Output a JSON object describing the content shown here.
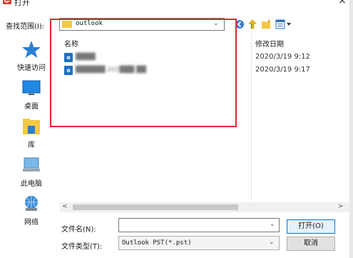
{
  "window": {
    "title": "打开",
    "close_glyph": "×"
  },
  "lookin": {
    "label": "查找范围(I):",
    "value": "outlook"
  },
  "places": [
    {
      "label": "快速访问",
      "icon": "star-icon"
    },
    {
      "label": "桌面",
      "icon": "desktop-icon"
    },
    {
      "label": "库",
      "icon": "library-icon"
    },
    {
      "label": "此电脑",
      "icon": "computer-icon"
    },
    {
      "label": "网络",
      "icon": "network-icon"
    }
  ],
  "filelist": {
    "columns": {
      "name": "名称",
      "date": "修改日期"
    },
    "rows": [
      {
        "name": "████",
        "date": "2020/3/19 9:12"
      },
      {
        "name": "██████ 202███ ██",
        "date": "2020/3/19 9:17"
      }
    ]
  },
  "filename": {
    "label": "文件名(N):",
    "value": ""
  },
  "filetype": {
    "label": "文件类型(T):",
    "value": "Outlook PST(*.pst)"
  },
  "buttons": {
    "open": "打开(O)",
    "cancel": "取消"
  },
  "colors": {
    "highlight_box": "#e0272b",
    "accent": "#0078d7"
  }
}
